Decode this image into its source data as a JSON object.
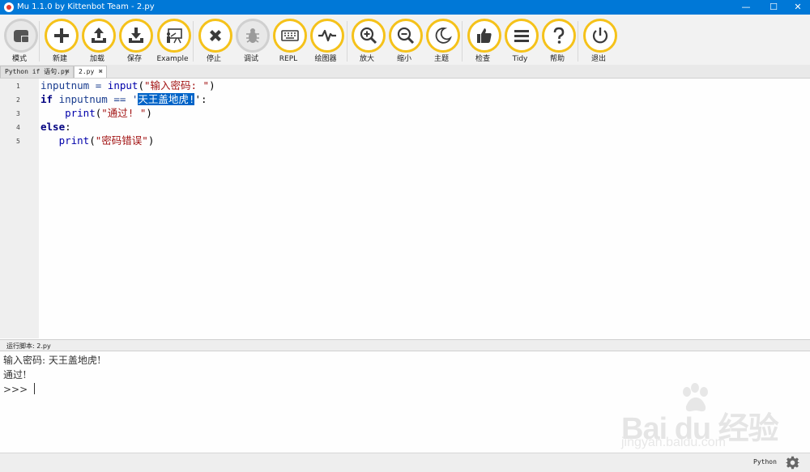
{
  "window": {
    "title": "Mu 1.1.0 by Kittenbot Team - 2.py",
    "controls": {
      "minimize": "—",
      "maximize": "☐",
      "close": "✕"
    }
  },
  "toolbar": {
    "accent_color": "#f5c21a",
    "buttons": [
      {
        "label": "模式",
        "icon": "mode-icon"
      },
      {
        "label": "新建",
        "icon": "plus-icon"
      },
      {
        "label": "加载",
        "icon": "upload-icon"
      },
      {
        "label": "保存",
        "icon": "download-icon"
      },
      {
        "label": "Example",
        "icon": "presentation-icon"
      },
      {
        "label": "停止",
        "icon": "close-icon"
      },
      {
        "label": "调试",
        "icon": "bug-icon"
      },
      {
        "label": "REPL",
        "icon": "keyboard-icon"
      },
      {
        "label": "绘图器",
        "icon": "pulse-icon"
      },
      {
        "label": "放大",
        "icon": "zoom-in-icon"
      },
      {
        "label": "缩小",
        "icon": "zoom-out-icon"
      },
      {
        "label": "主题",
        "icon": "moon-icon"
      },
      {
        "label": "检查",
        "icon": "thumbs-up-icon"
      },
      {
        "label": "Tidy",
        "icon": "menu-lines-icon"
      },
      {
        "label": "帮助",
        "icon": "question-icon"
      },
      {
        "label": "退出",
        "icon": "power-icon"
      }
    ]
  },
  "tabs": [
    {
      "label": "Python if 语句.py",
      "close": "✖",
      "active": false
    },
    {
      "label": "2.py",
      "close": "✖",
      "active": true
    }
  ],
  "editor": {
    "line_numbers": [
      "1",
      "2",
      "3",
      "4",
      "5"
    ],
    "lines": [
      {
        "indent": "",
        "t1": "inputnum = ",
        "t2": "input",
        "t3": "(",
        "t4": "\"输入密码: \"",
        "t5": ")"
      },
      {
        "indent": "",
        "kw": "if",
        "t1": " inputnum == '",
        "sel": "天王盖地虎!",
        "t2": "':"
      },
      {
        "indent": "    ",
        "t1": "print",
        "t2": "(",
        "t3": "\"通过! \"",
        "t4": ")"
      },
      {
        "kw": "else",
        "t1": ":"
      },
      {
        "indent": "   ",
        "t1": "print",
        "t2": "(",
        "t3": "\"密码错误\"",
        "t4": ")"
      }
    ],
    "selection_color": "#0064c8"
  },
  "pane": {
    "header": "运行脚本: 2.py",
    "output": [
      "输入密码: 天王盖地虎!",
      "通过!"
    ],
    "prompt": ">>> "
  },
  "watermark": {
    "brand": "Bai du 经验",
    "url": "jingyan.baidu.com"
  },
  "statusbar": {
    "mode": "Python",
    "settings_icon": "gear-icon"
  }
}
